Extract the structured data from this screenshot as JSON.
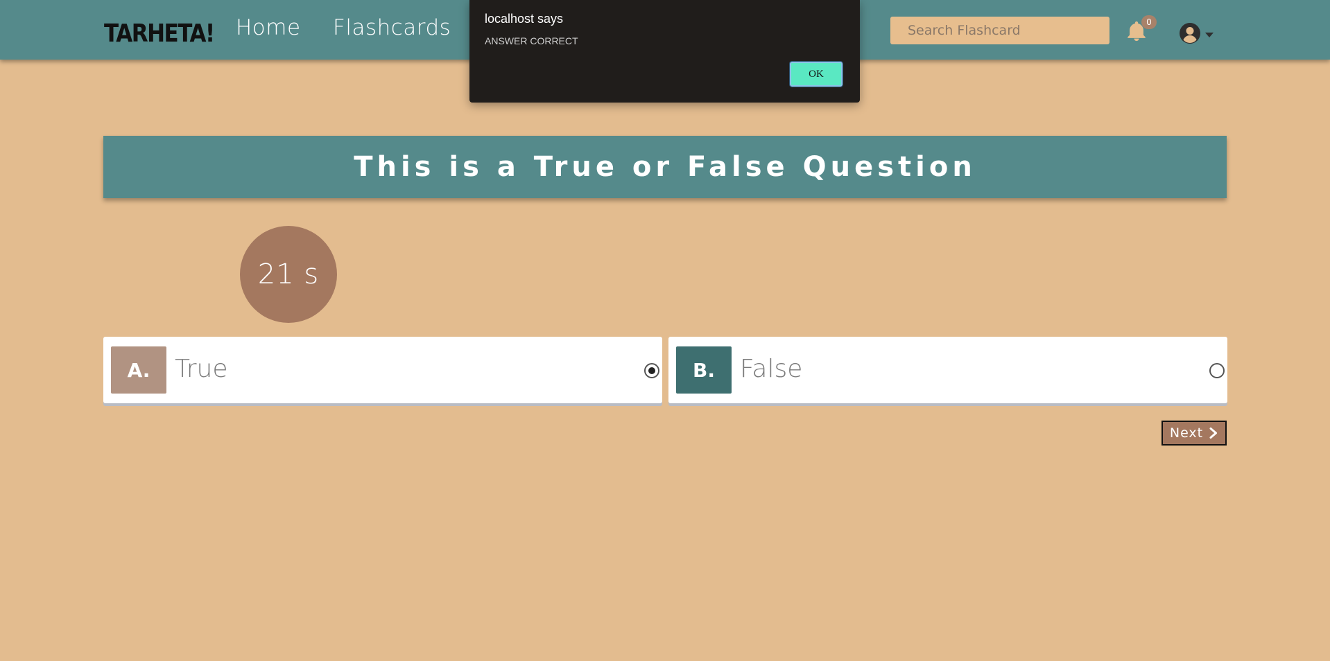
{
  "navbar": {
    "logo": "TARHETA!",
    "links": [
      "Home",
      "Flashcards"
    ],
    "search_placeholder": "Search Flashcard",
    "notification_count": "0",
    "icons": {
      "notifications": "bell-icon",
      "user": "user-circle-icon",
      "menu": "caret-down-icon"
    }
  },
  "dialog": {
    "title": "localhost says",
    "message": "ANSWER CORRECT",
    "ok_label": "OK"
  },
  "question": {
    "text": "This is a True or False Question"
  },
  "timer": {
    "label": "21 s"
  },
  "options": [
    {
      "letter": "A.",
      "text": "True",
      "selected": true
    },
    {
      "letter": "B.",
      "text": "False",
      "selected": false
    }
  ],
  "next_button": {
    "label": "Next",
    "icon": "chevron-right-icon"
  },
  "colors": {
    "background": "#e3bc8f",
    "navbar": "#558a8b",
    "accent_brown": "#a4785f",
    "option_a_letter": "#b19382",
    "option_b_letter": "#3e6f70",
    "dialog_ok": "#5ae8c2"
  }
}
